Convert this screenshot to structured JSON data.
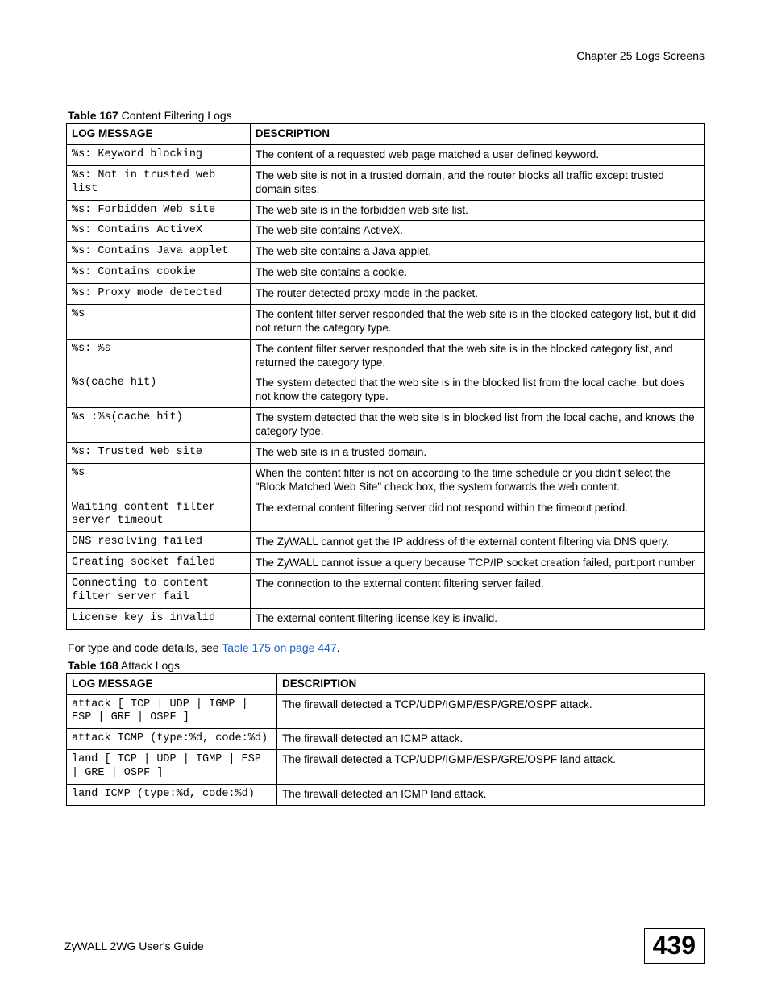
{
  "header": {
    "chapter": "Chapter 25 Logs Screens"
  },
  "table167": {
    "caption_bold": "Table 167",
    "caption_rest": "   Content Filtering Logs",
    "head_msg": "LOG MESSAGE",
    "head_desc": "DESCRIPTION",
    "rows": [
      {
        "msg": "%s: Keyword blocking",
        "desc": "The content of a requested web page matched a user defined keyword."
      },
      {
        "msg": "%s: Not in trusted web list",
        "desc": "The web site is not in a trusted domain, and the router blocks all traffic except trusted domain sites."
      },
      {
        "msg": "%s: Forbidden Web site",
        "desc": "The web site is in the forbidden web site list."
      },
      {
        "msg": "%s: Contains ActiveX",
        "desc": "The web site contains ActiveX."
      },
      {
        "msg": "%s: Contains Java applet",
        "desc": "The web site contains a Java applet."
      },
      {
        "msg": "%s: Contains cookie",
        "desc": "The web site contains a cookie."
      },
      {
        "msg": "%s: Proxy mode detected",
        "desc": "The router detected proxy mode in the packet."
      },
      {
        "msg": "%s",
        "desc": "The content filter server responded that the web site is in the blocked category list, but it did not return the category type."
      },
      {
        "msg": "%s: %s",
        "desc": "The content filter server responded that the web site is in the blocked category list, and returned the category type."
      },
      {
        "msg": "%s(cache hit)",
        "desc": "The system detected that the web site is in the blocked list from the local cache, but does not know the category type."
      },
      {
        "msg": "%s :%s(cache hit)",
        "desc": "The system detected that the web site is in blocked list from the local cache, and knows the category type."
      },
      {
        "msg": "%s: Trusted Web site",
        "desc": "The web site is in a trusted domain."
      },
      {
        "msg": "%s",
        "desc": "When the content filter is not on according to the time schedule or you didn't select the  \"Block Matched Web Site\" check box, the system forwards the web content."
      },
      {
        "msg": "Waiting content filter server timeout",
        "desc": "The external content filtering server did not respond within the timeout period."
      },
      {
        "msg": "DNS resolving failed",
        "desc": "The ZyWALL cannot get the IP address of the external content filtering via DNS query."
      },
      {
        "msg": "Creating socket failed",
        "desc": "The ZyWALL cannot issue a query because TCP/IP socket creation failed, port:port number."
      },
      {
        "msg": "Connecting to content filter server fail",
        "desc": "The connection to the external content filtering server failed."
      },
      {
        "msg": "License key is invalid",
        "desc": "The external content filtering license key is invalid."
      }
    ]
  },
  "note_text_before": "For type and code details, see ",
  "note_link": "Table 175 on page 447",
  "note_text_after": ".",
  "table168": {
    "caption_bold": "Table 168",
    "caption_rest": "   Attack Logs",
    "head_msg": "LOG MESSAGE",
    "head_desc": "DESCRIPTION",
    "rows": [
      {
        "msg": "attack [ TCP | UDP | IGMP | ESP | GRE | OSPF ]",
        "desc": "The firewall detected a TCP/UDP/IGMP/ESP/GRE/OSPF attack."
      },
      {
        "msg": "attack ICMP (type:%d, code:%d)",
        "desc": "The firewall detected an ICMP attack."
      },
      {
        "msg": "land [ TCP | UDP | IGMP | ESP | GRE | OSPF ]",
        "desc": "The firewall detected a TCP/UDP/IGMP/ESP/GRE/OSPF land attack."
      },
      {
        "msg": "land ICMP (type:%d, code:%d)",
        "desc": "The firewall detected an ICMP land attack."
      }
    ]
  },
  "footer": {
    "guide": "ZyWALL 2WG User's Guide",
    "page": "439"
  }
}
